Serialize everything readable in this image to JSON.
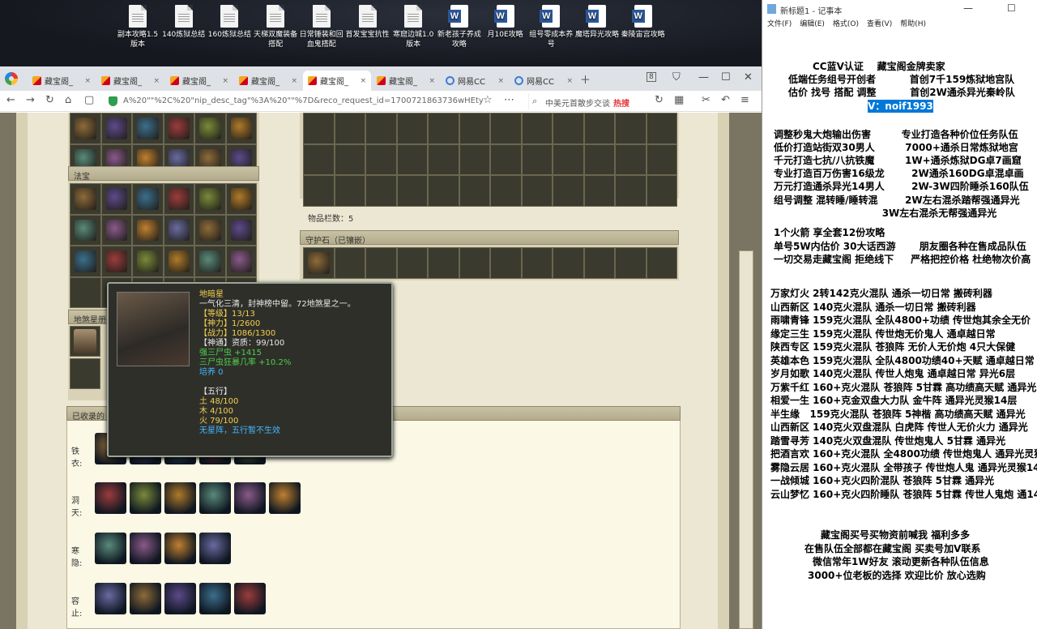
{
  "desktop": {
    "icons": [
      {
        "label": "副本攻略1.5版本",
        "type": "doc"
      },
      {
        "label": "140炼狱总结",
        "type": "doc"
      },
      {
        "label": "160炼狱总结",
        "type": "doc"
      },
      {
        "label": "天梯双魔装备搭配",
        "type": "doc"
      },
      {
        "label": "日常锤装和回血鬼搭配",
        "type": "doc"
      },
      {
        "label": "首发宝宝抗性",
        "type": "doc"
      },
      {
        "label": "寒窟边城1.0版本",
        "type": "doc"
      },
      {
        "label": "新老孩子养成攻略",
        "type": "word"
      },
      {
        "label": "月10E攻略",
        "type": "word"
      },
      {
        "label": "组号零成本养号",
        "type": "word"
      },
      {
        "label": "魔塔异光攻略",
        "type": "word"
      },
      {
        "label": "秦陵宙宫攻略",
        "type": "word"
      }
    ]
  },
  "browser": {
    "tabs": [
      {
        "label": "藏宝阁_",
        "fav": "cbg",
        "active": false
      },
      {
        "label": "藏宝阁_",
        "fav": "cbg",
        "active": false
      },
      {
        "label": "藏宝阁_",
        "fav": "cbg",
        "active": false
      },
      {
        "label": "藏宝阁_",
        "fav": "cbg",
        "active": false
      },
      {
        "label": "藏宝阁_",
        "fav": "cbg",
        "active": true
      },
      {
        "label": "藏宝阁_",
        "fav": "cbg",
        "active": false
      },
      {
        "label": "网易CC",
        "fav": "netease",
        "active": false
      },
      {
        "label": "网易CC",
        "fav": "netease",
        "active": false
      }
    ],
    "tab_count": "8",
    "url": "A%20\"\"%2C%20\"nip_desc_tag\"%3A%20\"\"%7D&reco_request_id=1700721863736wHEty",
    "search_placeholder": "中美元首散步交谈",
    "search_hot": "热搜"
  },
  "game": {
    "section_fabao": "法宝",
    "section_dishaxing": "地煞星册",
    "section_shoulu": "已收录的",
    "item_slots_label": "物品栏数：5",
    "shouhushi_title": "守护石（已镶嵌）",
    "rows": [
      {
        "label": "铁衣:"
      },
      {
        "label": "洞天:"
      },
      {
        "label": "寒隐:"
      },
      {
        "label": "容止:"
      }
    ],
    "tooltip": {
      "name": "地暗星",
      "desc": "一气化三清，封神榜中留。72地煞星之一。",
      "level": "【等级】13/13",
      "shenli": "【神力】1/2600",
      "zhanli": "【战力】1086/1300",
      "shentong": "【神通】资质：99/100",
      "bonus1": "强三尸虫 +1415",
      "bonus2": "三尸虫狂暴几率 +10.2%",
      "peiyang": "培养 0",
      "wuxing": "【五行】",
      "tu": "土 48/100",
      "mu": "木 4/100",
      "huo": "火 79/100",
      "footer": "无星阵，五行暂不生效"
    }
  },
  "notepad": {
    "title": "新标题1 - 记事本",
    "menu": [
      "文件(F)",
      "编辑(E)",
      "格式(O)",
      "查看(V)",
      "帮助(H)"
    ],
    "lines": [
      "CC蓝V认证    藏宝阁金牌卖家",
      "低端任务组号开创者          首创7千159炼狱地宫队",
      "估价 找号 搭配 调整          首创2W通杀异光秦岭队",
      "V：noif1993",
      "调整秒鬼大炮输出伤害         专业打造各种价位任务队伍",
      "低价打造站街双30男人         7000+通杀日常炼狱地宫",
      "千元打造七抗/八抗铁魔         1W+通杀炼狱DG卓7画窟",
      "专业打造百万伤害16级龙        2W通杀160DG卓混卓画",
      "万元打造通杀异光14男人        2W-3W四阶睡杀160队伍",
      "组号调整 混转睡/睡转混        2W左右混杀踏帮强通异光",
      "                                3W左右混杀无帮强通异光",
      "1个火箭 享全套12份攻略",
      "单号5W内估价 30大话西游       朋友圈各种在售成品队伍",
      "一切交易走藏宝阁 拒绝线下     严格把控价格 杜绝物次价高",
      "万家灯火 2转142克火混队 通杀一切日常 搬砖利器",
      "山西新区 140克火混队 通杀一切日常 搬砖利器",
      "雨啸青锋 159克火混队 全队4800+功绩 传世炮其余全无价",
      "缘定三生 159克火混队 传世炮无价鬼人 通卓越日常",
      "陕西专区 159克火混队 苍狼阵 无价人无价炮 4只大保健",
      "英雄本色 159克火混队 全队4800功绩40+天赋 通卓越日常",
      "岁月如歌 140克火混队 传世人炮鬼 通卓越日常 异光6层",
      "万紫千红 160+克火混队 苍狼阵 5甘霖 高功绩高天赋 通异光",
      "相爱一生 160+克金双盘大力队 金牛阵 通异光灵猴14层",
      "半生缘   159克火混队 苍狼阵 5神楷 高功绩高天赋 通异光",
      "山西新区 140克火双盘混队 白虎阵 传世人无价火力 通异光",
      "踏雪寻芳 140克火双盘混队 传世炮鬼人 5甘霖 通异光",
      "把酒言欢 160+克火混队 全4800功绩 传世炮鬼人 通异光灵猴",
      "雾隐云居 160+克火混队 全带孩子 传世炮人鬼 通异光灵猴14",
      "一战倾城 160+克火四阶混队 苍狼阵 5甘霖 通异光",
      "云山梦忆 160+克火四阶睡队 苍狼阵 5甘霖 传世人鬼炮 通14",
      "藏宝阁买号买物资前喊我 福利多多",
      "在售队伍全部都在藏宝阁 买卖号加V联系",
      "微信常年1W好友 滚动更新各种队伍信息",
      "3000+位老板的选择 欢迎比价 放心选购"
    ]
  },
  "colors": {
    "selection": "#0078d7",
    "tooltip_yellow": "#f0d050",
    "tooltip_green": "#4cd04a",
    "tooltip_cyan": "#42b8ff"
  }
}
